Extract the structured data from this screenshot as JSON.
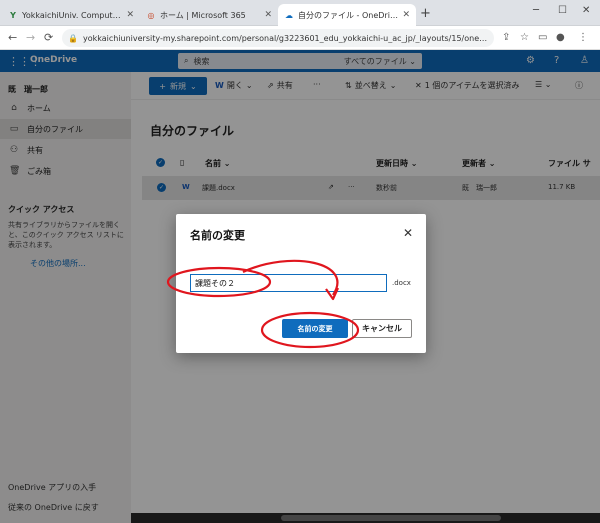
{
  "browser": {
    "tabs": [
      {
        "label": "YokkaichiUniv. ComputerCenter |",
        "favicon": "Y"
      },
      {
        "label": "ホーム | Microsoft 365",
        "favicon": "◎"
      },
      {
        "label": "自分のファイル - OneDrive",
        "favicon": "☁"
      }
    ],
    "url": "yokkaichiuniversity-my.sharepoint.com/personal/g3223601_edu_yokkaichi-u_ac_jp/_layouts/15/onedrive.a..."
  },
  "header": {
    "app_title": "OneDrive",
    "search_placeholder": "検索",
    "search_scope": "すべてのファイル ⌄"
  },
  "sidebar": {
    "user_name": "既　瑞一郎",
    "items": [
      {
        "label": "ホーム"
      },
      {
        "label": "自分のファイル"
      },
      {
        "label": "共有"
      },
      {
        "label": "ごみ箱"
      }
    ],
    "quick_access_title": "クイック アクセス",
    "quick_access_desc": "共有ライブラリからファイルを開くと、このクイック アクセス リストに表示されます。",
    "other_places": "その他の場所...",
    "footer_get_app": "OneDrive アプリの入手",
    "footer_classic": "従来の OneDrive に戻す"
  },
  "commandbar": {
    "new_label": "新規",
    "open_label": "開く",
    "share_label": "共有",
    "more": "···",
    "sort_label": "並べ替え",
    "selected_label": "1 個のアイテムを選択済み"
  },
  "main": {
    "page_title": "自分のファイル",
    "columns": {
      "name": "名前 ⌄",
      "modified": "更新日時 ⌄",
      "modified_by": "更新者 ⌄",
      "size": "ファイル サ"
    },
    "rows": [
      {
        "name": "課題.docx",
        "modified": "数秒前",
        "modified_by": "既　瑞一郎",
        "size": "11.7 KB"
      }
    ]
  },
  "dialog": {
    "title": "名前の変更",
    "input_value": "課題その２",
    "extension": ".docx",
    "primary_label": "名前の変更",
    "secondary_label": "キャンセル"
  },
  "colors": {
    "accent": "#0f6cbd",
    "annotation": "#e0161e"
  }
}
